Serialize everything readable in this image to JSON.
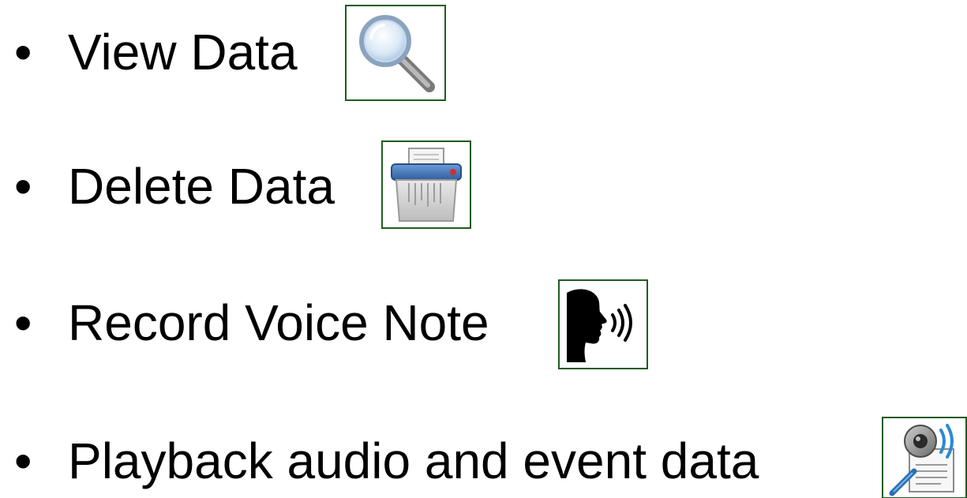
{
  "bullet_char": "•",
  "items": [
    {
      "label": "View Data",
      "icon": "magnifying-glass-icon"
    },
    {
      "label": "Delete Data",
      "icon": "shredder-icon"
    },
    {
      "label": "Record Voice Note",
      "icon": "speaking-head-icon"
    },
    {
      "label": "Playback audio and event data",
      "icon": "speaker-document-icon"
    }
  ],
  "colors": {
    "icon_border": "#1f5c1f",
    "text": "#000000",
    "background": "#ffffff"
  }
}
